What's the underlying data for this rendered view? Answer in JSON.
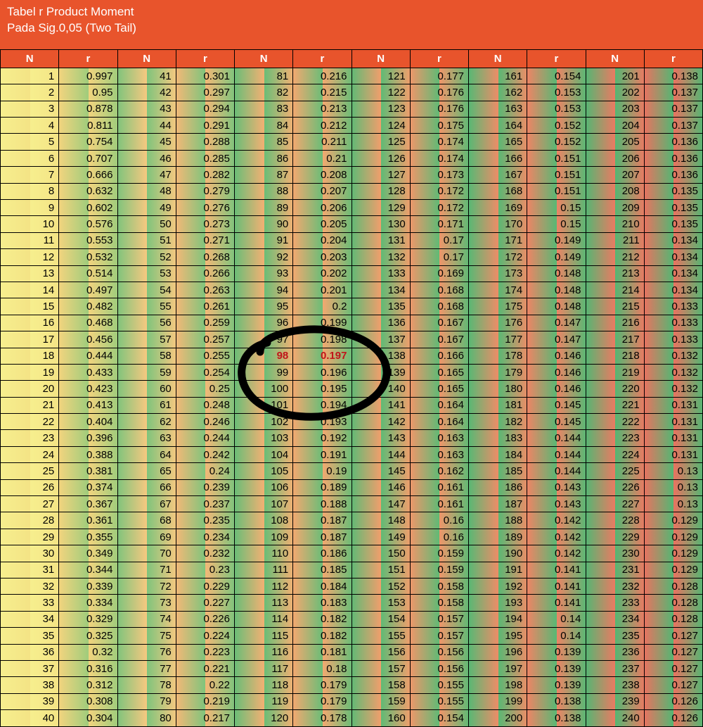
{
  "chart_data": {
    "type": "table",
    "title": "Tabel r Product Moment",
    "subtitle": "Pada Sig.0,05 (Two Tail)",
    "column_pairs": 6,
    "N_header": "N",
    "r_header": "r",
    "highlight": {
      "N": 98,
      "r": 0.197
    },
    "rows": [
      [
        1,
        0.997,
        41,
        0.301,
        81,
        0.216,
        121,
        0.177,
        161,
        0.154,
        201,
        0.138
      ],
      [
        2,
        0.95,
        42,
        0.297,
        82,
        0.215,
        122,
        0.176,
        162,
        0.153,
        202,
        0.137
      ],
      [
        3,
        0.878,
        43,
        0.294,
        83,
        0.213,
        123,
        0.176,
        163,
        0.153,
        203,
        0.137
      ],
      [
        4,
        0.811,
        44,
        0.291,
        84,
        0.212,
        124,
        0.175,
        164,
        0.152,
        204,
        0.137
      ],
      [
        5,
        0.754,
        45,
        0.288,
        85,
        0.211,
        125,
        0.174,
        165,
        0.152,
        205,
        0.136
      ],
      [
        6,
        0.707,
        46,
        0.285,
        86,
        0.21,
        126,
        0.174,
        166,
        0.151,
        206,
        0.136
      ],
      [
        7,
        0.666,
        47,
        0.282,
        87,
        0.208,
        127,
        0.173,
        167,
        0.151,
        207,
        0.136
      ],
      [
        8,
        0.632,
        48,
        0.279,
        88,
        0.207,
        128,
        0.172,
        168,
        0.151,
        208,
        0.135
      ],
      [
        9,
        0.602,
        49,
        0.276,
        89,
        0.206,
        129,
        0.172,
        169,
        0.15,
        209,
        0.135
      ],
      [
        10,
        0.576,
        50,
        0.273,
        90,
        0.205,
        130,
        0.171,
        170,
        0.15,
        210,
        0.135
      ],
      [
        11,
        0.553,
        51,
        0.271,
        91,
        0.204,
        131,
        0.17,
        171,
        0.149,
        211,
        0.134
      ],
      [
        12,
        0.532,
        52,
        0.268,
        92,
        0.203,
        132,
        0.17,
        172,
        0.149,
        212,
        0.134
      ],
      [
        13,
        0.514,
        53,
        0.266,
        93,
        0.202,
        133,
        0.169,
        173,
        0.148,
        213,
        0.134
      ],
      [
        14,
        0.497,
        54,
        0.263,
        94,
        0.201,
        134,
        0.168,
        174,
        0.148,
        214,
        0.134
      ],
      [
        15,
        0.482,
        55,
        0.261,
        95,
        0.2,
        135,
        0.168,
        175,
        0.148,
        215,
        0.133
      ],
      [
        16,
        0.468,
        56,
        0.259,
        96,
        0.199,
        136,
        0.167,
        176,
        0.147,
        216,
        0.133
      ],
      [
        17,
        0.456,
        57,
        0.257,
        97,
        0.198,
        137,
        0.167,
        177,
        0.147,
        217,
        0.133
      ],
      [
        18,
        0.444,
        58,
        0.255,
        98,
        0.197,
        138,
        0.166,
        178,
        0.146,
        218,
        0.132
      ],
      [
        19,
        0.433,
        59,
        0.254,
        99,
        0.196,
        139,
        0.165,
        179,
        0.146,
        219,
        0.132
      ],
      [
        20,
        0.423,
        60,
        0.25,
        100,
        0.195,
        140,
        0.165,
        180,
        0.146,
        220,
        0.132
      ],
      [
        21,
        0.413,
        61,
        0.248,
        101,
        0.194,
        141,
        0.164,
        181,
        0.145,
        221,
        0.131
      ],
      [
        22,
        0.404,
        62,
        0.246,
        102,
        0.193,
        142,
        0.164,
        182,
        0.145,
        222,
        0.131
      ],
      [
        23,
        0.396,
        63,
        0.244,
        103,
        0.192,
        143,
        0.163,
        183,
        0.144,
        223,
        0.131
      ],
      [
        24,
        0.388,
        64,
        0.242,
        104,
        0.191,
        144,
        0.163,
        184,
        0.144,
        224,
        0.131
      ],
      [
        25,
        0.381,
        65,
        0.24,
        105,
        0.19,
        145,
        0.162,
        185,
        0.144,
        225,
        0.13
      ],
      [
        26,
        0.374,
        66,
        0.239,
        106,
        0.189,
        146,
        0.161,
        186,
        0.143,
        226,
        0.13
      ],
      [
        27,
        0.367,
        67,
        0.237,
        107,
        0.188,
        147,
        0.161,
        187,
        0.143,
        227,
        0.13
      ],
      [
        28,
        0.361,
        68,
        0.235,
        108,
        0.187,
        148,
        0.16,
        188,
        0.142,
        228,
        0.129
      ],
      [
        29,
        0.355,
        69,
        0.234,
        109,
        0.187,
        149,
        0.16,
        189,
        0.142,
        229,
        0.129
      ],
      [
        30,
        0.349,
        70,
        0.232,
        110,
        0.186,
        150,
        0.159,
        190,
        0.142,
        230,
        0.129
      ],
      [
        31,
        0.344,
        71,
        0.23,
        111,
        0.185,
        151,
        0.159,
        191,
        0.141,
        231,
        0.129
      ],
      [
        32,
        0.339,
        72,
        0.229,
        112,
        0.184,
        152,
        0.158,
        192,
        0.141,
        232,
        0.128
      ],
      [
        33,
        0.334,
        73,
        0.227,
        113,
        0.183,
        153,
        0.158,
        193,
        0.141,
        233,
        0.128
      ],
      [
        34,
        0.329,
        74,
        0.226,
        114,
        0.182,
        154,
        0.157,
        194,
        0.14,
        234,
        0.128
      ],
      [
        35,
        0.325,
        75,
        0.224,
        115,
        0.182,
        155,
        0.157,
        195,
        0.14,
        235,
        0.127
      ],
      [
        36,
        0.32,
        76,
        0.223,
        116,
        0.181,
        156,
        0.156,
        196,
        0.139,
        236,
        0.127
      ],
      [
        37,
        0.316,
        77,
        0.221,
        117,
        0.18,
        157,
        0.156,
        197,
        0.139,
        237,
        0.127
      ],
      [
        38,
        0.312,
        78,
        0.22,
        118,
        0.179,
        158,
        0.155,
        198,
        0.139,
        238,
        0.127
      ],
      [
        39,
        0.308,
        79,
        0.219,
        119,
        0.179,
        159,
        0.155,
        199,
        0.138,
        239,
        0.126
      ],
      [
        40,
        0.304,
        80,
        0.217,
        120,
        0.178,
        160,
        0.154,
        200,
        0.138,
        240,
        0.126
      ]
    ]
  }
}
